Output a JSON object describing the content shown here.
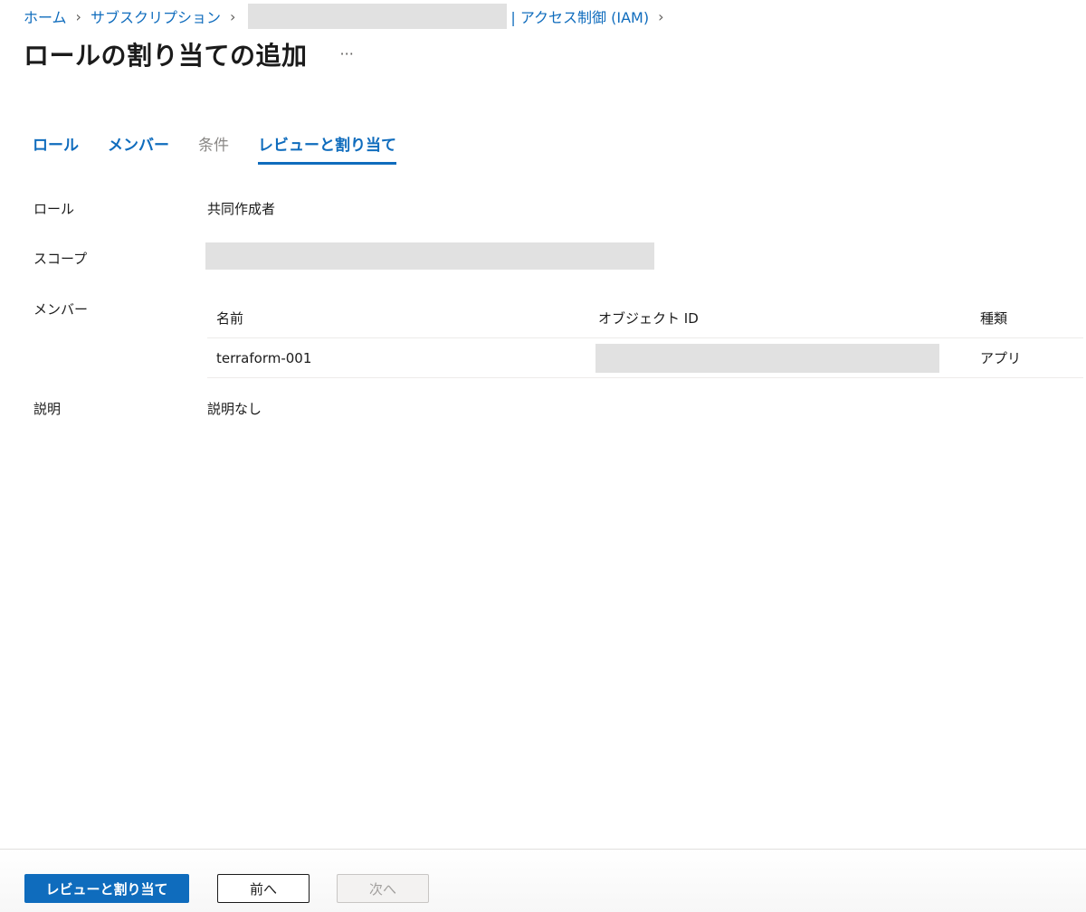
{
  "breadcrumb": {
    "items": [
      {
        "label": "ホーム"
      },
      {
        "label": "サブスクリプション"
      },
      {
        "label": "| アクセス制御 (IAM)"
      }
    ]
  },
  "header": {
    "title": "ロールの割り当ての追加",
    "more_label": "···"
  },
  "tabs": [
    {
      "label": "ロール",
      "state": "enabled"
    },
    {
      "label": "メンバー",
      "state": "enabled"
    },
    {
      "label": "条件",
      "state": "disabled"
    },
    {
      "label": "レビューと割り当て",
      "state": "active"
    }
  ],
  "review": {
    "role_label": "ロール",
    "role_value": "共同作成者",
    "scope_label": "スコープ",
    "members_label": "メンバー",
    "description_label": "説明",
    "description_value": "説明なし"
  },
  "members_table": {
    "columns": [
      "名前",
      "オブジェクト ID",
      "種類"
    ],
    "rows": [
      {
        "name": "terraform-001",
        "type": "アプリ"
      }
    ]
  },
  "footer": {
    "review_assign_label": "レビューと割り当て",
    "prev_label": "前へ",
    "next_label": "次へ"
  },
  "colors": {
    "accent": "#0f6cbd",
    "redacted": "#e1e1e1"
  }
}
